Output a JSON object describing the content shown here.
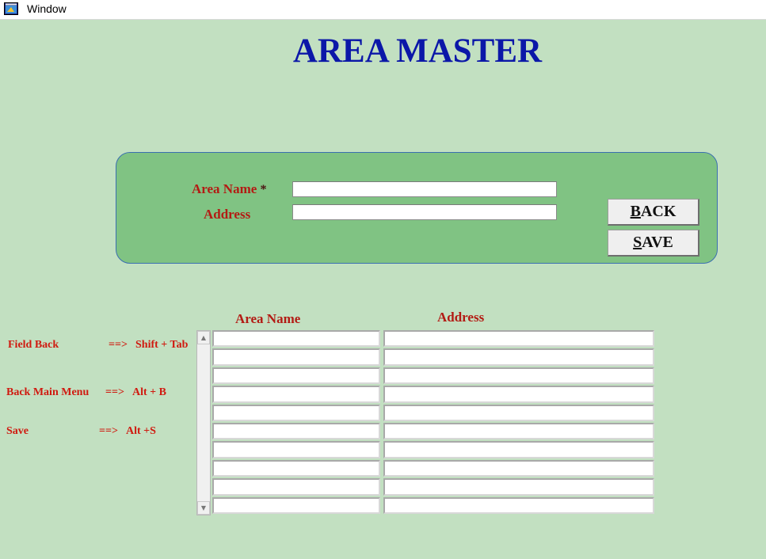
{
  "window": {
    "title": "Window",
    "icon": "app-window-icon"
  },
  "page_title": "AREA MASTER",
  "form": {
    "area_name_label": "Area Name",
    "required_mark": "*",
    "address_label": "Address",
    "area_name_value": "",
    "address_value": ""
  },
  "buttons": {
    "back": {
      "underlined": "B",
      "rest": "ACK"
    },
    "save": {
      "underlined": "S",
      "rest": "AVE"
    }
  },
  "table": {
    "headers": [
      "Area Name",
      "Address"
    ],
    "rows": [
      [
        "",
        ""
      ],
      [
        "",
        ""
      ],
      [
        "",
        ""
      ],
      [
        "",
        ""
      ],
      [
        "",
        ""
      ],
      [
        "",
        ""
      ],
      [
        "",
        ""
      ],
      [
        "",
        ""
      ],
      [
        "",
        ""
      ],
      [
        "",
        ""
      ]
    ]
  },
  "shortcuts": [
    {
      "label": "Field Back",
      "arrow": "==>",
      "keys": "Shift + Tab"
    },
    {
      "label": "Back Main Menu",
      "arrow": "==>",
      "keys": "Alt + B"
    },
    {
      "label": "Save",
      "arrow": "==>",
      "keys": "Alt +S"
    }
  ],
  "scrollbar": {
    "up_icon": "scroll-up-arrow-icon",
    "down_icon": "scroll-down-arrow-icon"
  },
  "colors": {
    "background": "#c2e0c1",
    "panel": "#80c383",
    "title": "#0b17a8",
    "label": "#b31b14",
    "hint": "#d01a10"
  }
}
